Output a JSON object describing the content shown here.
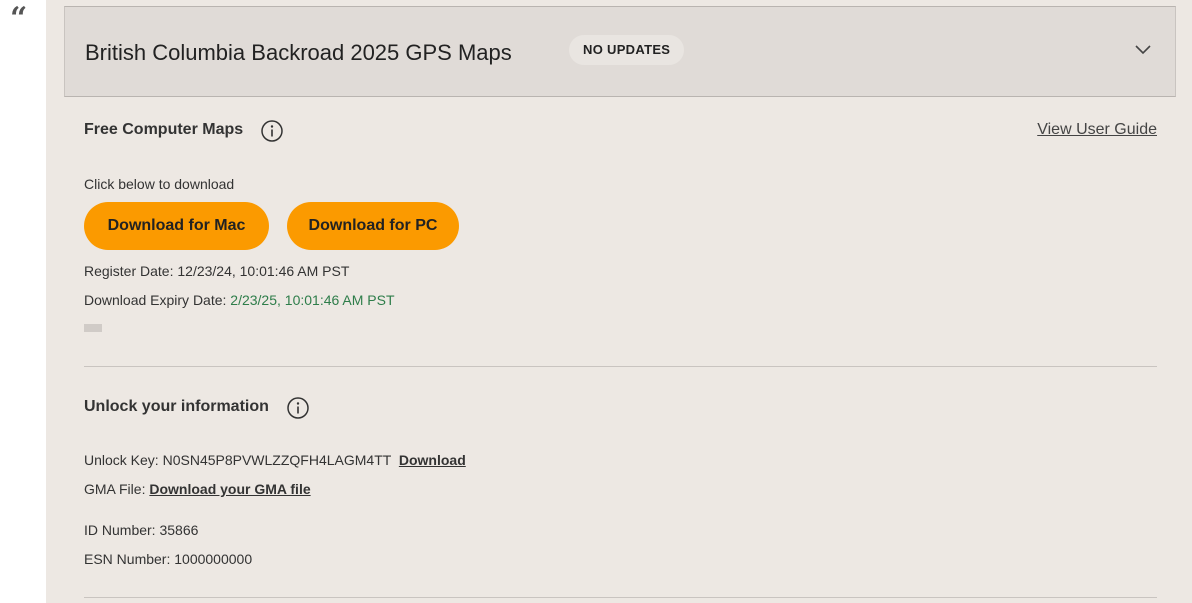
{
  "decor": {
    "quote_mark": "“"
  },
  "header": {
    "title": "British Columbia Backroad 2025 GPS Maps",
    "badge": "NO UPDATES"
  },
  "free_maps": {
    "title": "Free Computer Maps",
    "guide_link": "View User Guide",
    "instruction": "Click below to download",
    "mac_button": "Download for Mac",
    "pc_button": "Download for PC",
    "register_label": "Register Date:",
    "register_value": "12/23/24, 10:01:46 AM PST",
    "expiry_label": "Download Expiry Date:",
    "expiry_value": "2/23/25, 10:01:46 AM PST"
  },
  "unlock": {
    "title": "Unlock your information",
    "key_label": "Unlock Key:",
    "key_value": "N0SN45P8PVWLZZQFH4LAGM4TT",
    "key_download": "Download",
    "gma_label": "GMA File:",
    "gma_link": "Download your GMA file",
    "id_label": "ID Number:",
    "id_value": "35866",
    "esn_label": "ESN Number:",
    "esn_value": "1000000000"
  },
  "colors": {
    "accent_button": "#fb9a00",
    "panel_bg": "#ede8e3",
    "header_bg": "#e0dbd7",
    "expiry_green": "#2e7d4a"
  },
  "icons": {
    "info": "info-circle-icon",
    "chevron": "chevron-down-icon"
  }
}
